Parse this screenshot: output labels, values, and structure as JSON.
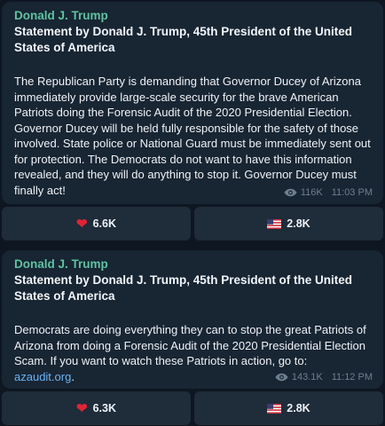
{
  "posts": [
    {
      "author": "Donald J. Trump",
      "title": "Statement by Donald J. Trump, 45th President of the United States of America",
      "body": "The Republican Party is demanding that Governor Ducey of Arizona immediately provide large-scale security for the brave American Patriots doing the Forensic Audit of the 2020 Presidential Election. Governor Ducey will be held fully responsible for the safety of those involved. State police or National Guard must be immediately sent out for protection. The Democrats do not want to have this information revealed, and they will do anything to stop it. Governor Ducey must finally act!",
      "views": "116K",
      "time": "11:03 PM",
      "reactions": [
        {
          "icon": "heart-icon",
          "count": "6.6K"
        },
        {
          "icon": "us-flag-icon",
          "count": "2.8K"
        }
      ]
    },
    {
      "author": "Donald J. Trump",
      "title": "Statement by Donald J. Trump, 45th President of the United States of America",
      "body": "Democrats are doing everything they can to stop the great Patriots of Arizona from doing a Forensic Audit of the 2020 Presidential Election Scam. If you want to watch these Patriots in action, go to:",
      "link": "azaudit.org",
      "link_suffix": ".",
      "views": "143.1K",
      "time": "11:12 PM",
      "reactions": [
        {
          "icon": "heart-icon",
          "count": "6.3K"
        },
        {
          "icon": "us-flag-icon",
          "count": "2.8K"
        }
      ]
    }
  ],
  "colors": {
    "background": "#0e1621",
    "bubble": "#182533",
    "author": "#5ec3a1",
    "link": "#6ab3f3",
    "meta": "#6d7f8f",
    "heart": "#e02434"
  }
}
